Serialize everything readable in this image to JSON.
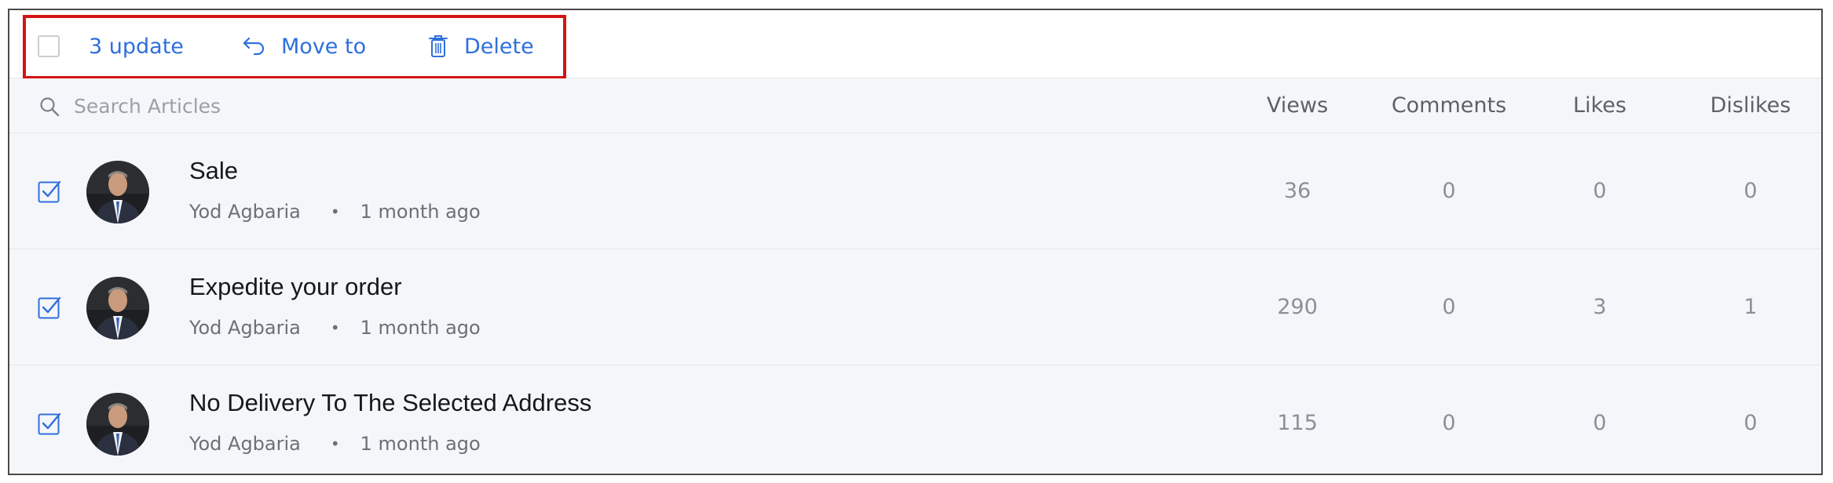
{
  "toolbar": {
    "update_label": "3 update",
    "move_label": "Move to",
    "delete_label": "Delete",
    "highlight_color": "#d31414",
    "accent_color": "#2f6fdc"
  },
  "search": {
    "placeholder": "Search Articles"
  },
  "columns": {
    "views": "Views",
    "comments": "Comments",
    "likes": "Likes",
    "dislikes": "Dislikes"
  },
  "articles": [
    {
      "title": "Sale",
      "author": "Yod Agbaria",
      "time": "1 month ago",
      "views": "36",
      "comments": "0",
      "likes": "0",
      "dislikes": "0",
      "checked": true
    },
    {
      "title": "Expedite your order",
      "author": "Yod Agbaria",
      "time": "1 month ago",
      "views": "290",
      "comments": "0",
      "likes": "3",
      "dislikes": "1",
      "checked": true
    },
    {
      "title": "No Delivery To The Selected Address",
      "author": "Yod Agbaria",
      "time": "1 month ago",
      "views": "115",
      "comments": "0",
      "likes": "0",
      "dislikes": "0",
      "checked": true
    }
  ],
  "meta_separator": "•",
  "icons": {
    "move": "reply-arrow-icon",
    "delete": "trash-icon",
    "search": "search-icon",
    "check": "checkbox-checked-icon"
  }
}
